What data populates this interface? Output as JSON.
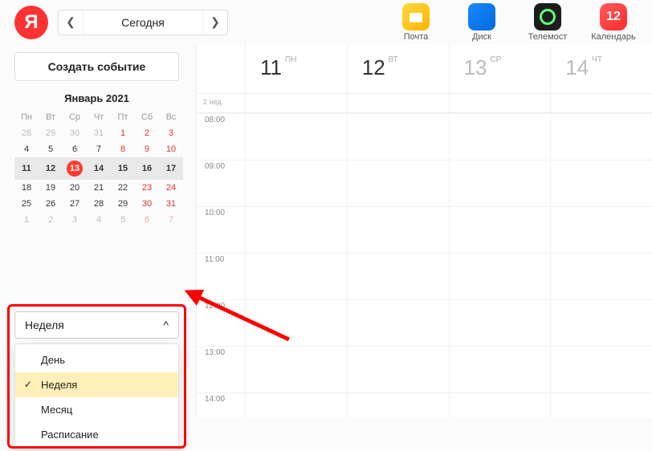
{
  "header": {
    "logo_letter": "Я",
    "today_label": "Сегодня"
  },
  "apps": [
    {
      "name": "mail",
      "label": "Почта"
    },
    {
      "name": "disk",
      "label": "Диск"
    },
    {
      "name": "telemost",
      "label": "Телемост"
    },
    {
      "name": "calendar",
      "label": "Календарь",
      "badge": "12",
      "active": true
    }
  ],
  "sidebar": {
    "create_label": "Создать событие",
    "month_title": "Январь 2021",
    "dow": [
      "Пн",
      "Вт",
      "Ср",
      "Чт",
      "Пт",
      "Сб",
      "Вс"
    ],
    "weeks": [
      [
        {
          "d": "28",
          "dim": true
        },
        {
          "d": "29",
          "dim": true
        },
        {
          "d": "30",
          "dim": true
        },
        {
          "d": "31",
          "dim": true
        },
        {
          "d": "1",
          "wk": true
        },
        {
          "d": "2",
          "wk": true
        },
        {
          "d": "3",
          "wk": true
        }
      ],
      [
        {
          "d": "4"
        },
        {
          "d": "5"
        },
        {
          "d": "6"
        },
        {
          "d": "7"
        },
        {
          "d": "8",
          "wk": true
        },
        {
          "d": "9",
          "wk": true
        },
        {
          "d": "10",
          "wk": true
        }
      ],
      [
        {
          "d": "11"
        },
        {
          "d": "12"
        },
        {
          "d": "13",
          "today": true
        },
        {
          "d": "14"
        },
        {
          "d": "15"
        },
        {
          "d": "16"
        },
        {
          "d": "17"
        }
      ],
      [
        {
          "d": "18"
        },
        {
          "d": "19"
        },
        {
          "d": "20"
        },
        {
          "d": "21"
        },
        {
          "d": "22"
        },
        {
          "d": "23",
          "wk": true
        },
        {
          "d": "24",
          "wk": true
        }
      ],
      [
        {
          "d": "25"
        },
        {
          "d": "26"
        },
        {
          "d": "27"
        },
        {
          "d": "28"
        },
        {
          "d": "29"
        },
        {
          "d": "30",
          "wk": true
        },
        {
          "d": "31",
          "wk": true
        }
      ],
      [
        {
          "d": "1",
          "dim": true
        },
        {
          "d": "2",
          "dim": true
        },
        {
          "d": "3",
          "dim": true
        },
        {
          "d": "4",
          "dim": true
        },
        {
          "d": "5",
          "dim": true
        },
        {
          "d": "6",
          "wkdim": true
        },
        {
          "d": "7",
          "wkdim": true
        }
      ]
    ],
    "current_week_index": 2
  },
  "view_select": {
    "current": "Неделя",
    "options": [
      "День",
      "Неделя",
      "Месяц",
      "Расписание"
    ],
    "selected_index": 1
  },
  "grid": {
    "week_label": "2 нед.",
    "days": [
      {
        "num": "11",
        "abbr": "ПН"
      },
      {
        "num": "12",
        "abbr": "ВТ"
      },
      {
        "num": "13",
        "abbr": "СР"
      },
      {
        "num": "14",
        "abbr": "ЧТ"
      }
    ],
    "hours": [
      "08:00",
      "09:00",
      "10:00",
      "11:00",
      "12:00",
      "13:00",
      "14:00"
    ]
  }
}
